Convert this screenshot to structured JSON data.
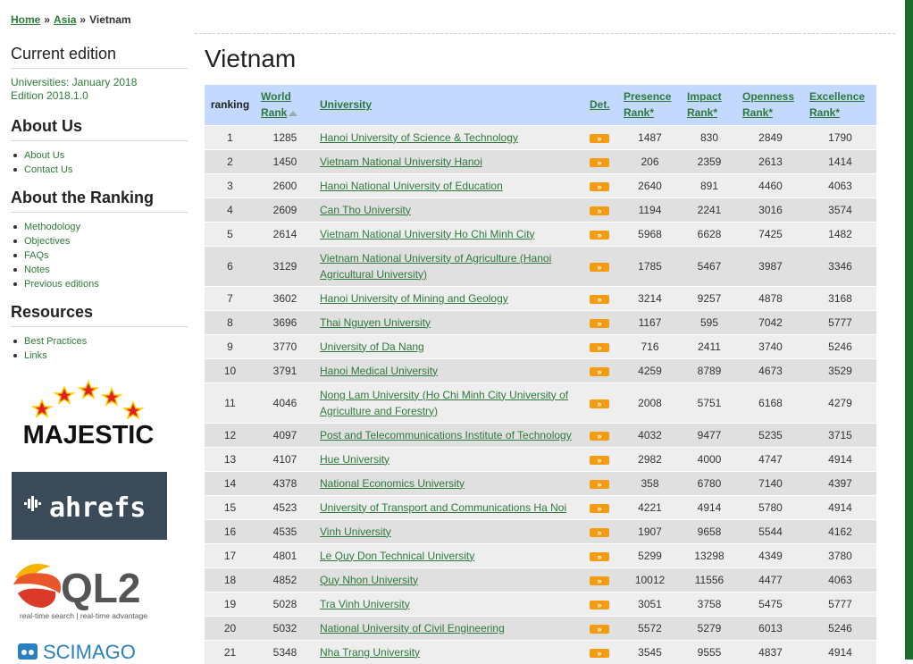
{
  "breadcrumb": {
    "home": "Home",
    "sep1": "»",
    "asia": "Asia",
    "sep2": "»",
    "current": "Vietnam"
  },
  "sidebar": {
    "current_edition": {
      "title": "Current edition",
      "line1": "Universities: January 2018",
      "line2": "Edition 2018.1.0"
    },
    "about_us": {
      "title": "About Us",
      "items": [
        "About Us",
        "Contact Us"
      ]
    },
    "about_ranking": {
      "title": "About the Ranking",
      "items": [
        "Methodology",
        "Objectives",
        "FAQs",
        "Notes",
        "Previous editions"
      ]
    },
    "resources": {
      "title": "Resources",
      "items": [
        "Best Practices",
        "Links"
      ]
    }
  },
  "logos": {
    "majestic": "MAJESTIC",
    "ahrefs": "ahrefs",
    "ql2": "QL2",
    "ql2_tagline": "real-time search | real-time advantage",
    "scimago": "SCIMAGO"
  },
  "page_title": "Vietnam",
  "table": {
    "headers": {
      "ranking": "ranking",
      "world_rank_1": "World",
      "world_rank_2": "Rank",
      "university": "University",
      "det": "Det.",
      "presence_1": "Presence",
      "presence_2": "Rank*",
      "impact_1": "Impact",
      "impact_2": "Rank*",
      "openness_1": "Openness",
      "openness_2": "Rank*",
      "excellence_1": "Excellence",
      "excellence_2": "Rank*"
    },
    "det_glyph": "»",
    "rows": [
      {
        "rank": "1",
        "world": "1285",
        "uni": "Hanoi University of Science & Technology",
        "presence": "1487",
        "impact": "830",
        "openness": "2849",
        "excellence": "1790"
      },
      {
        "rank": "2",
        "world": "1450",
        "uni": "Vietnam National University Hanoi",
        "presence": "206",
        "impact": "2359",
        "openness": "2613",
        "excellence": "1414"
      },
      {
        "rank": "3",
        "world": "2600",
        "uni": "Hanoi National University of Education",
        "presence": "2640",
        "impact": "891",
        "openness": "4460",
        "excellence": "4063"
      },
      {
        "rank": "4",
        "world": "2609",
        "uni": "Can Tho University",
        "presence": "1194",
        "impact": "2241",
        "openness": "3016",
        "excellence": "3574"
      },
      {
        "rank": "5",
        "world": "2614",
        "uni": "Vietnam National University Ho Chi Minh City",
        "presence": "5968",
        "impact": "6628",
        "openness": "7425",
        "excellence": "1482"
      },
      {
        "rank": "6",
        "world": "3129",
        "uni": "Vietnam National University of Agriculture (Hanoi Agricultural University)",
        "presence": "1785",
        "impact": "5467",
        "openness": "3987",
        "excellence": "3346"
      },
      {
        "rank": "7",
        "world": "3602",
        "uni": "Hanoi University of Mining and Geology",
        "presence": "3214",
        "impact": "9257",
        "openness": "4878",
        "excellence": "3168"
      },
      {
        "rank": "8",
        "world": "3696",
        "uni": "Thai Nguyen University",
        "presence": "1167",
        "impact": "595",
        "openness": "7042",
        "excellence": "5777"
      },
      {
        "rank": "9",
        "world": "3770",
        "uni": "University of Da Nang",
        "presence": "716",
        "impact": "2411",
        "openness": "3740",
        "excellence": "5246"
      },
      {
        "rank": "10",
        "world": "3791",
        "uni": "Hanoi Medical University",
        "presence": "4259",
        "impact": "8789",
        "openness": "4673",
        "excellence": "3529"
      },
      {
        "rank": "11",
        "world": "4046",
        "uni": "Nong Lam University (Ho Chi Minh City University of Agriculture and Forestry)",
        "presence": "2008",
        "impact": "5751",
        "openness": "6168",
        "excellence": "4279"
      },
      {
        "rank": "12",
        "world": "4097",
        "uni": "Post and Telecommunications Institute of Technology",
        "presence": "4032",
        "impact": "9477",
        "openness": "5235",
        "excellence": "3715"
      },
      {
        "rank": "13",
        "world": "4107",
        "uni": "Hue University",
        "presence": "2982",
        "impact": "4000",
        "openness": "4747",
        "excellence": "4914"
      },
      {
        "rank": "14",
        "world": "4378",
        "uni": "National Economics University",
        "presence": "358",
        "impact": "6780",
        "openness": "7140",
        "excellence": "4397"
      },
      {
        "rank": "15",
        "world": "4523",
        "uni": "University of Transport and Communications Ha Noi",
        "presence": "4221",
        "impact": "4914",
        "openness": "5780",
        "excellence": "4914"
      },
      {
        "rank": "16",
        "world": "4535",
        "uni": "Vinh University",
        "presence": "1907",
        "impact": "9658",
        "openness": "5544",
        "excellence": "4162"
      },
      {
        "rank": "17",
        "world": "4801",
        "uni": "Le Quy Don Technical University",
        "presence": "5299",
        "impact": "13298",
        "openness": "4349",
        "excellence": "3780"
      },
      {
        "rank": "18",
        "world": "4852",
        "uni": "Quy Nhon University",
        "presence": "10012",
        "impact": "11556",
        "openness": "4477",
        "excellence": "4063"
      },
      {
        "rank": "19",
        "world": "5028",
        "uni": "Tra Vinh University",
        "presence": "3051",
        "impact": "3758",
        "openness": "5475",
        "excellence": "5777"
      },
      {
        "rank": "20",
        "world": "5032",
        "uni": "National University of Civil Engineering",
        "presence": "5572",
        "impact": "5279",
        "openness": "6013",
        "excellence": "5246"
      },
      {
        "rank": "21",
        "world": "5348",
        "uni": "Nha Trang University",
        "presence": "3545",
        "impact": "9555",
        "openness": "4837",
        "excellence": "4914"
      }
    ]
  }
}
